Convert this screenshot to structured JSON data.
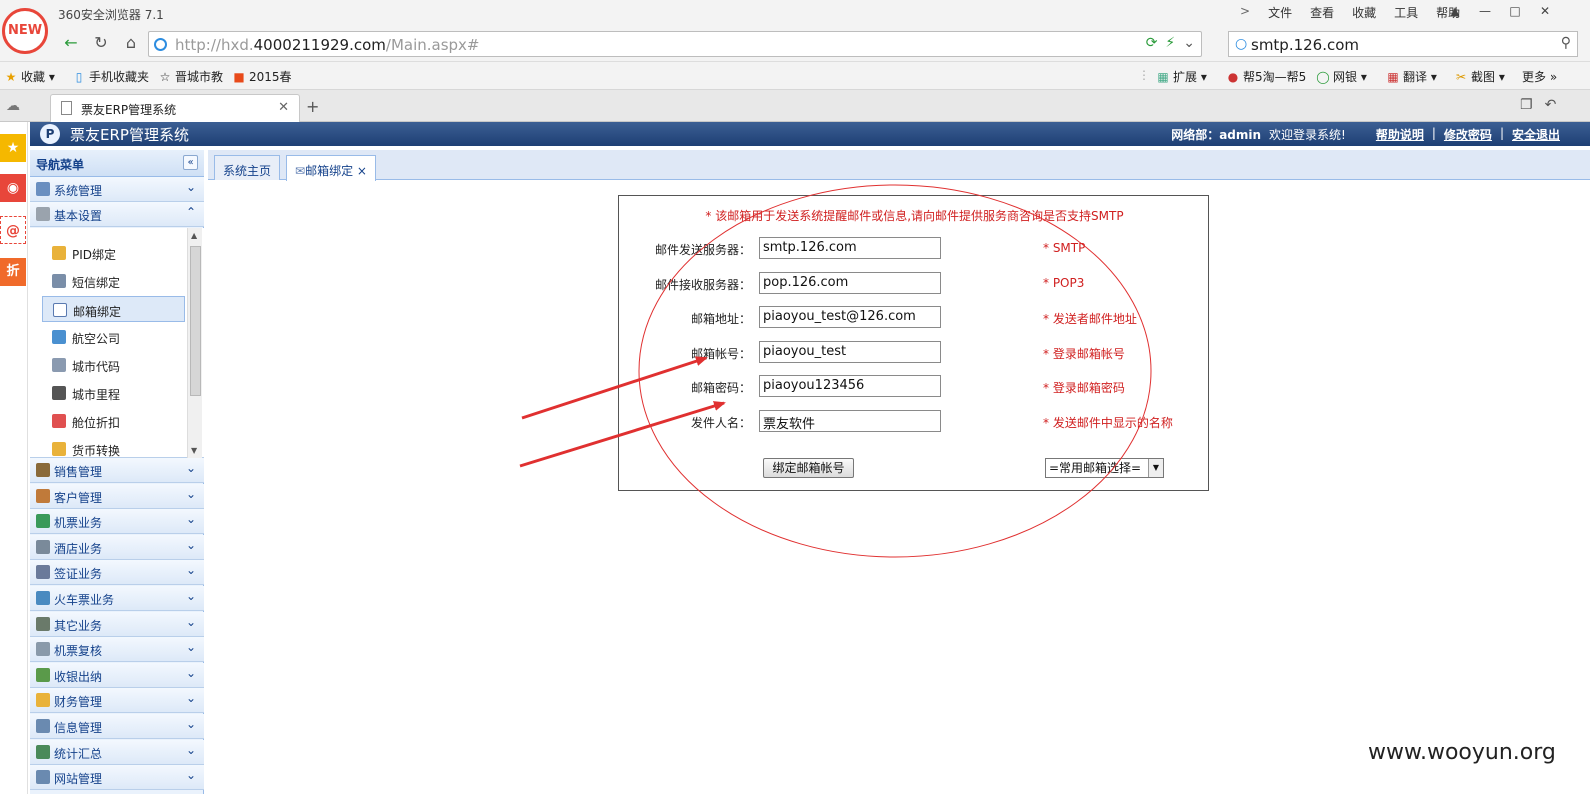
{
  "browser": {
    "badge": "NEW",
    "title": "360安全浏览器 7.1",
    "menu": [
      "文件",
      "查看",
      "收藏",
      "工具",
      "帮助"
    ],
    "url_prefix": "http://hxd.",
    "url_domain": "4000211929.com",
    "url_path": "/Main.aspx#",
    "search_value": "smtp.126.com",
    "bookmarks": [
      "收藏",
      "手机收藏夹",
      "晋城市教",
      "2015春"
    ],
    "toolbar_right": [
      "扩展",
      "帮5淘—帮5",
      "网银",
      "翻译",
      "截图",
      "更多"
    ],
    "tab_title": "票友ERP管理系统",
    "sidebar_icons": [
      "收藏",
      "微博",
      "邮件",
      "折"
    ]
  },
  "app": {
    "name": "票友ERP管理系统",
    "user": "网络部：admin",
    "welcome": "欢迎登录系统!",
    "links": [
      "帮助说明",
      "修改密码",
      "安全退出"
    ]
  },
  "nav": {
    "title": "导航菜单",
    "groups_top": [
      "系统管理",
      "基本设置"
    ],
    "sub_items": [
      "PID绑定",
      "短信绑定",
      "邮箱绑定",
      "航空公司",
      "城市代码",
      "城市里程",
      "舱位折扣",
      "货币转换"
    ],
    "groups_bottom": [
      "销售管理",
      "客户管理",
      "机票业务",
      "酒店业务",
      "签证业务",
      "火车票业务",
      "其它业务",
      "机票复核",
      "收银出纳",
      "财务管理",
      "信息管理",
      "统计汇总",
      "网站管理"
    ]
  },
  "content_tabs": [
    "系统主页",
    "邮箱绑定"
  ],
  "form": {
    "tip": "* 该邮箱用于发送系统提醒邮件或信息,请向邮件提供服务商咨询是否支持SMTP",
    "rows": [
      {
        "label": "邮件发送服务器：",
        "value": "smtp.126.com",
        "note": "* SMTP"
      },
      {
        "label": "邮件接收服务器：",
        "value": "pop.126.com",
        "note": "* POP3"
      },
      {
        "label": "邮箱地址：",
        "value": "piaoyou_test@126.com",
        "note": "* 发送者邮件地址"
      },
      {
        "label": "邮箱帐号：",
        "value": "piaoyou_test",
        "note": "* 登录邮箱帐号"
      },
      {
        "label": "邮箱密码：",
        "value": "piaoyou123456",
        "note": "* 登录邮箱密码"
      },
      {
        "label": "发件人名：",
        "value": "票友软件",
        "note": "* 发送邮件中显示的名称"
      }
    ],
    "bind_button": "绑定邮箱帐号",
    "mailbox_select": "=常用邮箱选择="
  },
  "watermark": "www.wooyun.org",
  "colors": {
    "header": "#1e3f74",
    "nav_text": "#15428b",
    "required_red": "#d02020",
    "annotation_red": "#e03030"
  }
}
